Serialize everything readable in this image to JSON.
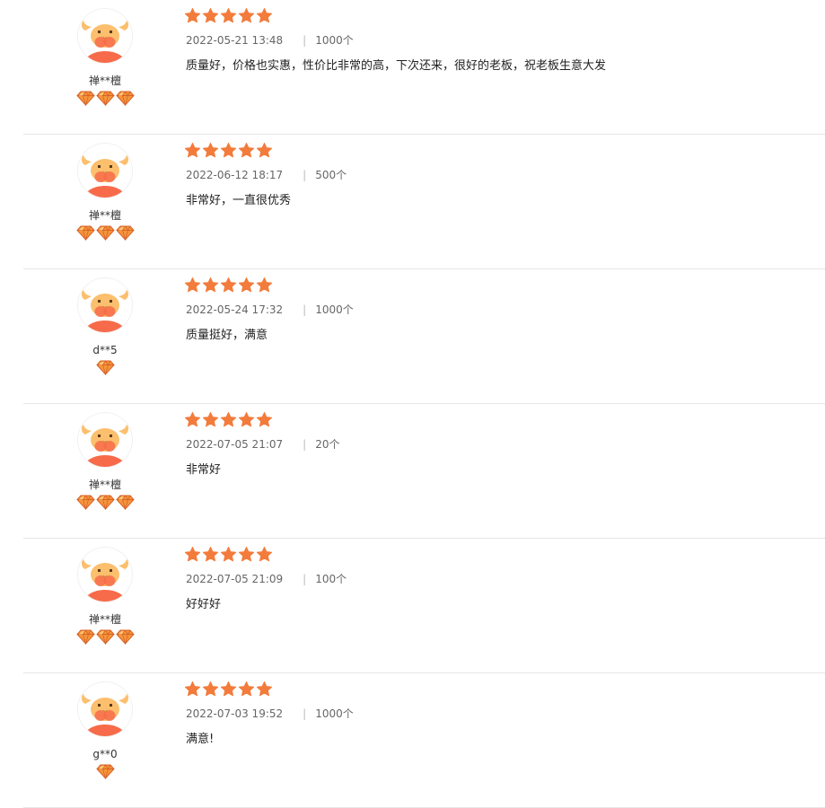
{
  "colors": {
    "star": "#f37b3b",
    "avatar_face": "#fbbf6e",
    "avatar_body": "#f76b4a",
    "gem": "#f5953a",
    "divider": "#e6e6e6"
  },
  "icons": {
    "avatar": "bull-avatar-icon",
    "star": "star-icon",
    "level": "diamond-icon",
    "separator": "|"
  },
  "reviews": [
    {
      "username": "禅**檀",
      "level_count": 3,
      "rating": 5,
      "date": "2022-05-21 13:48",
      "quantity": "1000个",
      "content": "质量好，价格也实惠，性价比非常的高，下次还来，很好的老板，祝老板生意大发"
    },
    {
      "username": "禅**檀",
      "level_count": 3,
      "rating": 5,
      "date": "2022-06-12 18:17",
      "quantity": "500个",
      "content": "非常好，一直很优秀"
    },
    {
      "username": "d**5",
      "level_count": 1,
      "rating": 5,
      "date": "2022-05-24 17:32",
      "quantity": "1000个",
      "content": "质量挺好，满意"
    },
    {
      "username": "禅**檀",
      "level_count": 3,
      "rating": 5,
      "date": "2022-07-05 21:07",
      "quantity": "20个",
      "content": "非常好"
    },
    {
      "username": "禅**檀",
      "level_count": 3,
      "rating": 5,
      "date": "2022-07-05 21:09",
      "quantity": "100个",
      "content": "好好好"
    },
    {
      "username": "g**0",
      "level_count": 1,
      "rating": 5,
      "date": "2022-07-03 19:52",
      "quantity": "1000个",
      "content": "满意!"
    }
  ]
}
